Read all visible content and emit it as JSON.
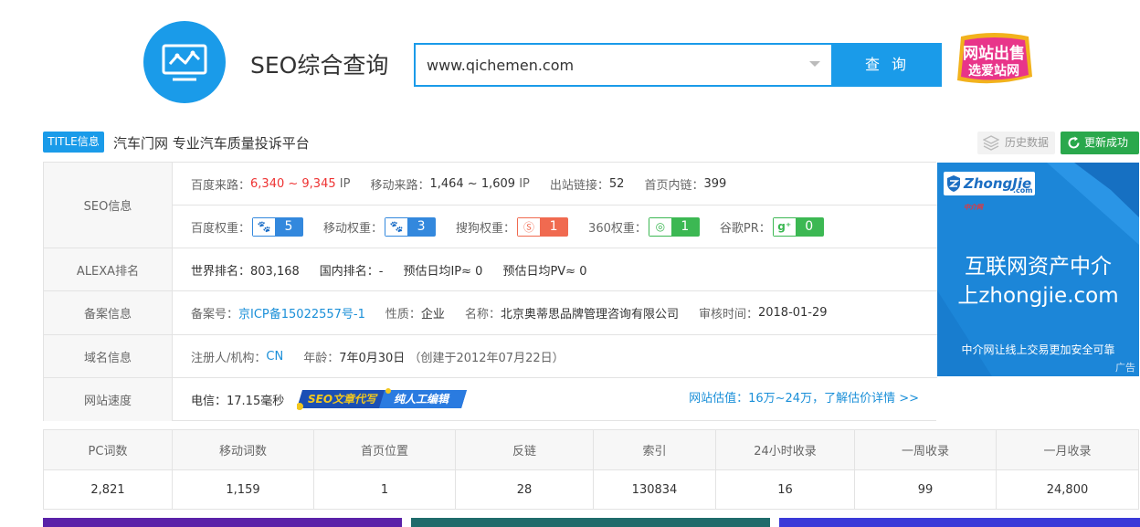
{
  "header": {
    "site_title": "SEO综合查询",
    "search_value": "www.qichemen.com",
    "search_button": "查 询",
    "sale_badge_line1": "网站出售",
    "sale_badge_line2": "选爱站网"
  },
  "title_info": {
    "tag": "TITLE信息",
    "text": "汽车门网 专业汽车质量投诉平台",
    "history_button": "历史数据",
    "update_button": "更新成功"
  },
  "seo": {
    "label": "SEO信息",
    "baidu_traffic_label": "百度来路：",
    "baidu_traffic_value": "6,340 ~ 9,345",
    "baidu_traffic_unit": "IP",
    "mobile_traffic_label": "移动来路：",
    "mobile_traffic_value": "1,464 ~ 1,609",
    "mobile_traffic_unit": "IP",
    "outlinks_label": "出站链接：",
    "outlinks_value": "52",
    "home_inlinks_label": "首页内链：",
    "home_inlinks_value": "399",
    "baidu_weight_label": "百度权重：",
    "baidu_weight_value": "5",
    "mobile_weight_label": "移动权重：",
    "mobile_weight_value": "3",
    "sogou_weight_label": "搜狗权重：",
    "sogou_weight_value": "1",
    "w360_label": "360权重：",
    "w360_value": "1",
    "google_pr_label": "谷歌PR：",
    "google_pr_value": "0"
  },
  "alexa": {
    "label": "ALEXA排名",
    "world_rank": "世界排名：803,168",
    "domestic_rank": "国内排名：-",
    "daily_ip": "预估日均IP≈ 0",
    "daily_pv": "预估日均PV≈ 0"
  },
  "icp": {
    "label": "备案信息",
    "number_label": "备案号：",
    "number_value": "京ICP备15022557号-1",
    "nature_label": "性质：",
    "nature_value": "企业",
    "name_label": "名称：",
    "name_value": "北京奥蒂思品牌管理咨询有限公司",
    "audit_label": "审核时间：",
    "audit_value": "2018-01-29"
  },
  "domain": {
    "label": "域名信息",
    "registrant_label": "注册人/机构：",
    "registrant_value": "CN",
    "age_label": "年龄：",
    "age_value": "7年0月30日",
    "age_note": "（创建于2012年07月22日）"
  },
  "speed": {
    "label": "网站速度",
    "telecom": "电信：17.15毫秒",
    "ad_text_1": "SEO文章代写",
    "ad_text_2": "纯人工编辑",
    "estimate_link": "网站估值：16万~24万，了解估价详情 >>"
  },
  "side_ad": {
    "logo_text": "ZhongJie",
    "logo_sup": "中介网",
    "logo_sub": ".com",
    "line1": "互联网资产中介",
    "line2": "上zhongjie.com",
    "line3": "中介网让线上交易更加安全可靠",
    "tag": "广告"
  },
  "stats": {
    "headers": [
      "PC词数",
      "移动词数",
      "首页位置",
      "反链",
      "索引",
      "24小时收录",
      "一周收录",
      "一月收录"
    ],
    "values": [
      "2,821",
      "1,159",
      "1",
      "28",
      "130834",
      "16",
      "99",
      "24,800"
    ]
  },
  "colors": {
    "primary": "#1a9be9",
    "green": "#2aa84c",
    "red": "#e33333",
    "link": "#1a8fd8"
  }
}
